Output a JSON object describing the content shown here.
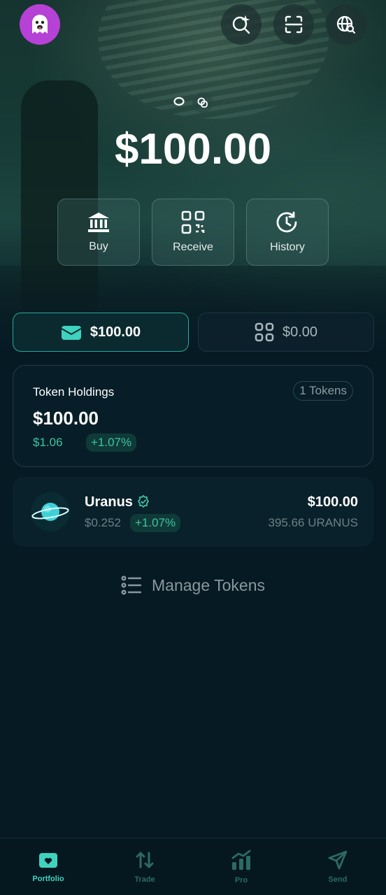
{
  "header": {
    "avatar_icon": "ghost-avatar",
    "buttons": [
      {
        "name": "search-sparkle-icon"
      },
      {
        "name": "scan-icon"
      },
      {
        "name": "globe-search-icon"
      }
    ]
  },
  "wallet": {
    "balance": "$100.00",
    "actions": [
      {
        "label": "Buy",
        "icon": "bank-icon"
      },
      {
        "label": "Receive",
        "icon": "qr-code-icon"
      },
      {
        "label": "History",
        "icon": "history-icon"
      }
    ]
  },
  "segments": {
    "tokens_value": "$100.00",
    "collectibles_value": "$0.00"
  },
  "holdings": {
    "title": "Token Holdings",
    "count": "1 Tokens",
    "value": "$100.00",
    "change_value": "$1.06",
    "change_percent": "+1.07%"
  },
  "tokens": [
    {
      "name": "Uranus",
      "price": "$0.252",
      "change": "+1.07%",
      "value": "$100.00",
      "amount": "395.66 URANUS"
    }
  ],
  "manage_label": "Manage Tokens",
  "nav": {
    "items": [
      {
        "label": "Portfolio",
        "active": true
      },
      {
        "label": "Trade"
      },
      {
        "label": "Pro"
      },
      {
        "label": "Send"
      }
    ]
  },
  "colors": {
    "accent": "#3fd3bf",
    "positive": "#3fc2a2",
    "background": "#061a24"
  }
}
